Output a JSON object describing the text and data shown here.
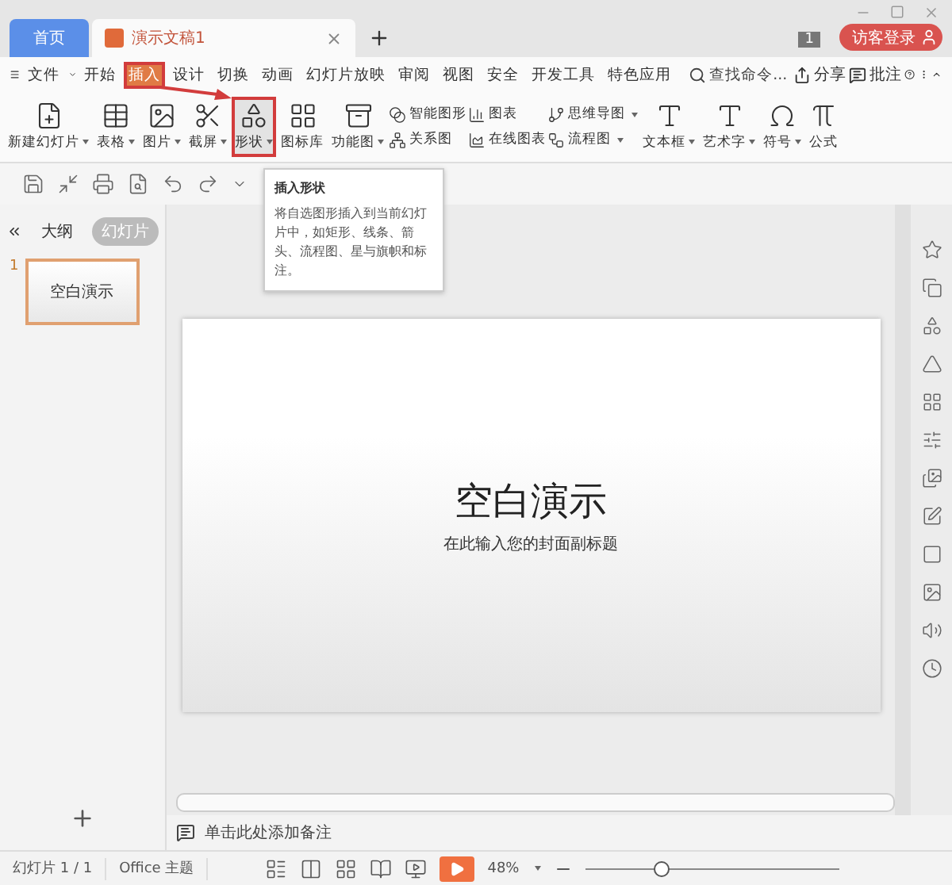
{
  "tabs": [
    {
      "label": "首页",
      "kind": "home",
      "selected": false
    },
    {
      "label": "演示文稿1",
      "kind": "document",
      "selected": true
    }
  ],
  "account": {
    "count": "1",
    "login": "访客登录"
  },
  "menu": [
    {
      "label": "文件",
      "selected": false,
      "highlighted": false
    },
    {
      "label": "开始",
      "selected": false,
      "highlighted": false
    },
    {
      "label": "插入",
      "selected": true,
      "highlighted": true
    },
    {
      "label": "设计",
      "selected": false,
      "highlighted": false
    },
    {
      "label": "切换",
      "selected": false,
      "highlighted": false
    },
    {
      "label": "动画",
      "selected": false,
      "highlighted": false
    },
    {
      "label": "幻灯片放映",
      "selected": false,
      "highlighted": false
    },
    {
      "label": "审阅",
      "selected": false,
      "highlighted": false
    },
    {
      "label": "视图",
      "selected": false,
      "highlighted": false
    },
    {
      "label": "安全",
      "selected": false,
      "highlighted": false
    },
    {
      "label": "开发工具",
      "selected": false,
      "highlighted": false
    },
    {
      "label": "特色应用",
      "selected": false,
      "highlighted": false
    }
  ],
  "search": {
    "placeholder": "查找命令..."
  },
  "menu_actions": [
    "分享",
    "批注"
  ],
  "ribbon": [
    {
      "kind": "large",
      "label": "新建幻灯片",
      "dropdown": true,
      "highlighted": false
    },
    {
      "kind": "large",
      "label": "表格",
      "dropdown": true,
      "highlighted": false
    },
    {
      "kind": "large",
      "label": "图片",
      "dropdown": true,
      "highlighted": false
    },
    {
      "kind": "large",
      "label": "截屏",
      "dropdown": true,
      "highlighted": false
    },
    {
      "kind": "large",
      "label": "形状",
      "dropdown": true,
      "highlighted": true
    },
    {
      "kind": "large",
      "label": "图标库",
      "dropdown": false,
      "highlighted": false
    },
    {
      "kind": "large",
      "label": "功能图",
      "dropdown": true,
      "highlighted": false
    },
    {
      "kind": "pair",
      "items": [
        {
          "label": "智能图形",
          "dropdown": false
        },
        {
          "label": "关系图",
          "dropdown": false
        }
      ]
    },
    {
      "kind": "pair",
      "items": [
        {
          "label": "图表",
          "dropdown": false
        },
        {
          "label": "在线图表",
          "dropdown": false
        }
      ]
    },
    {
      "kind": "pair",
      "items": [
        {
          "label": "思维导图",
          "dropdown": true
        },
        {
          "label": "流程图",
          "dropdown": true
        }
      ]
    },
    {
      "kind": "large",
      "label": "文本框",
      "dropdown": true,
      "highlighted": false
    },
    {
      "kind": "large",
      "label": "艺术字",
      "dropdown": true,
      "highlighted": false
    },
    {
      "kind": "large",
      "label": "符号",
      "dropdown": true,
      "highlighted": false
    },
    {
      "kind": "large",
      "label": "公式",
      "dropdown": false,
      "highlighted": false
    }
  ],
  "tooltip": {
    "title": "插入形状",
    "text": "将自选图形插入到当前幻灯片中，如矩形、线条、箭头、流程图、星与旗帜和标注。"
  },
  "panel_tabs": [
    {
      "label": "大纲",
      "selected": false
    },
    {
      "label": "幻灯片",
      "selected": true
    }
  ],
  "slides": [
    {
      "number": "1",
      "title": "空白演示",
      "selected": true
    }
  ],
  "slide": {
    "title": "空白演示",
    "subtitle": "在此输入您的封面副标题"
  },
  "notes": {
    "placeholder": "单击此处添加备注"
  },
  "status": {
    "slide": "幻灯片 1 / 1",
    "theme": "Office 主题",
    "zoom": "48%",
    "zoom_level": {
      "level": 0.3
    }
  }
}
